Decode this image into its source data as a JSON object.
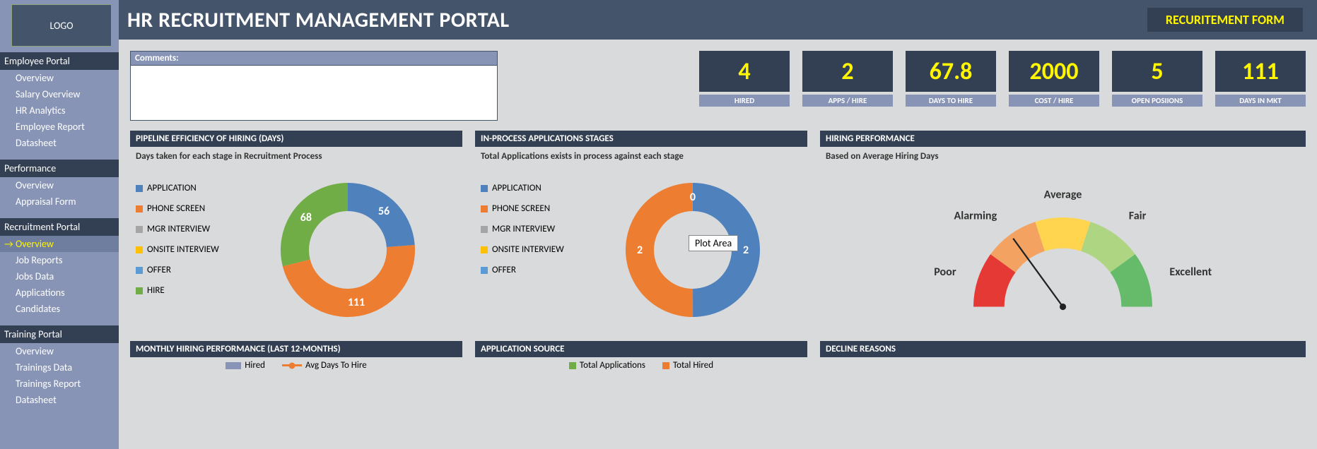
{
  "logo": "LOGO",
  "title": "HR RECRUITMENT MANAGEMENT PORTAL",
  "recruitment_button": "RECURITEMENT FORM",
  "sidebar": {
    "sections": [
      {
        "header": "Employee Portal",
        "items": [
          "Overview",
          "Salary Overview",
          "HR Analytics",
          "Employee Report",
          "Datasheet"
        ]
      },
      {
        "header": "Performance",
        "items": [
          "Overview",
          "Appraisal Form"
        ]
      },
      {
        "header": "Recruitment Portal",
        "items": [
          "Overview",
          "Job Reports",
          "Jobs Data",
          "Applications",
          "Candidates"
        ],
        "active_index": 0
      },
      {
        "header": "Training Portal",
        "items": [
          "Overview",
          "Trainings Data",
          "Trainings Report",
          "Datasheet"
        ]
      }
    ]
  },
  "comments_label": "Comments:",
  "kpis": [
    {
      "value": "4",
      "label": "HIRED"
    },
    {
      "value": "2",
      "label": "APPS / HIRE"
    },
    {
      "value": "67.8",
      "label": "DAYS TO HIRE"
    },
    {
      "value": "2000",
      "label": "COST / HIRE"
    },
    {
      "value": "5",
      "label": "OPEN POSIIONS"
    },
    {
      "value": "111",
      "label": "DAYS IN MKT"
    }
  ],
  "panel_pipeline": {
    "header": "PIPELINE EFFICIENCY OF HIRING (DAYS)",
    "sub": "Days taken for each stage in Recruitment Process",
    "legend": [
      "APPLICATION",
      "PHONE SCREEN",
      "MGR INTERVIEW",
      "ONSITE INTERVIEW",
      "OFFER",
      "HIRE"
    ]
  },
  "panel_inprocess": {
    "header": "IN-PROCESS APPLICATIONS STAGES",
    "sub": "Total Applications exists in process against each stage",
    "legend": [
      "APPLICATION",
      "PHONE SCREEN",
      "MGR INTERVIEW",
      "ONSITE INTERVIEW",
      "OFFER"
    ],
    "tooltip": "Plot Area"
  },
  "panel_hiring": {
    "header": "HIRING PERFORMANCE",
    "sub": "Based on Average Hiring Days",
    "labels": [
      "Poor",
      "Alarming",
      "Average",
      "Fair",
      "Excellent"
    ]
  },
  "panel_monthly": {
    "header": "MONTHLY HIRING PERFORMANCE (LAST 12-MONTHS)",
    "legend": [
      "Hired",
      "Avg Days To Hire"
    ]
  },
  "panel_source": {
    "header": "APPLICATION SOURCE",
    "legend": [
      "Total Applications",
      "Total Hired"
    ]
  },
  "panel_decline": {
    "header": "DECLINE REASONS"
  },
  "colors": {
    "series": [
      "#4f81bd",
      "#ed7d31",
      "#a5a5a5",
      "#ffc000",
      "#5b9bd5",
      "#70ad47"
    ],
    "gauge": [
      "#e53935",
      "#f4a261",
      "#ffd54f",
      "#aed581",
      "#66bb6a"
    ]
  },
  "chart_data": [
    {
      "type": "pie",
      "title": "PIPELINE EFFICIENCY OF HIRING (DAYS)",
      "subtitle": "Days taken for each stage in Recruitment Process",
      "categories": [
        "APPLICATION",
        "PHONE SCREEN",
        "MGR INTERVIEW",
        "ONSITE INTERVIEW",
        "OFFER",
        "HIRE"
      ],
      "values": [
        56,
        111,
        0,
        0,
        0,
        68
      ],
      "visible_labels": {
        "APPLICATION": 56,
        "PHONE SCREEN": 111,
        "HIRE": 68
      },
      "donut": true
    },
    {
      "type": "pie",
      "title": "IN-PROCESS APPLICATIONS STAGES",
      "subtitle": "Total Applications exists in process against each stage",
      "categories": [
        "APPLICATION",
        "PHONE SCREEN",
        "MGR INTERVIEW",
        "ONSITE INTERVIEW",
        "OFFER"
      ],
      "values": [
        2,
        2,
        0,
        0,
        0
      ],
      "visible_labels": {
        "APPLICATION": 2,
        "PHONE SCREEN": 2,
        "MGR INTERVIEW": 0
      },
      "donut": true
    },
    {
      "type": "pie",
      "title": "HIRING PERFORMANCE",
      "subtitle": "Based on Average Hiring Days",
      "categories": [
        "Poor",
        "Alarming",
        "Average",
        "Fair",
        "Excellent"
      ],
      "values": [
        1,
        1,
        1,
        1,
        1
      ],
      "gauge": true,
      "needle_category": "Alarming"
    },
    {
      "type": "bar",
      "title": "MONTHLY HIRING PERFORMANCE (LAST 12-MONTHS)",
      "series": [
        {
          "name": "Hired",
          "values": []
        },
        {
          "name": "Avg Days To Hire",
          "values": []
        }
      ],
      "categories": []
    },
    {
      "type": "bar",
      "title": "APPLICATION SOURCE",
      "series": [
        {
          "name": "Total Applications",
          "values": []
        },
        {
          "name": "Total Hired",
          "values": []
        }
      ],
      "categories": []
    },
    {
      "type": "bar",
      "title": "DECLINE REASONS",
      "categories": [],
      "values": []
    }
  ]
}
